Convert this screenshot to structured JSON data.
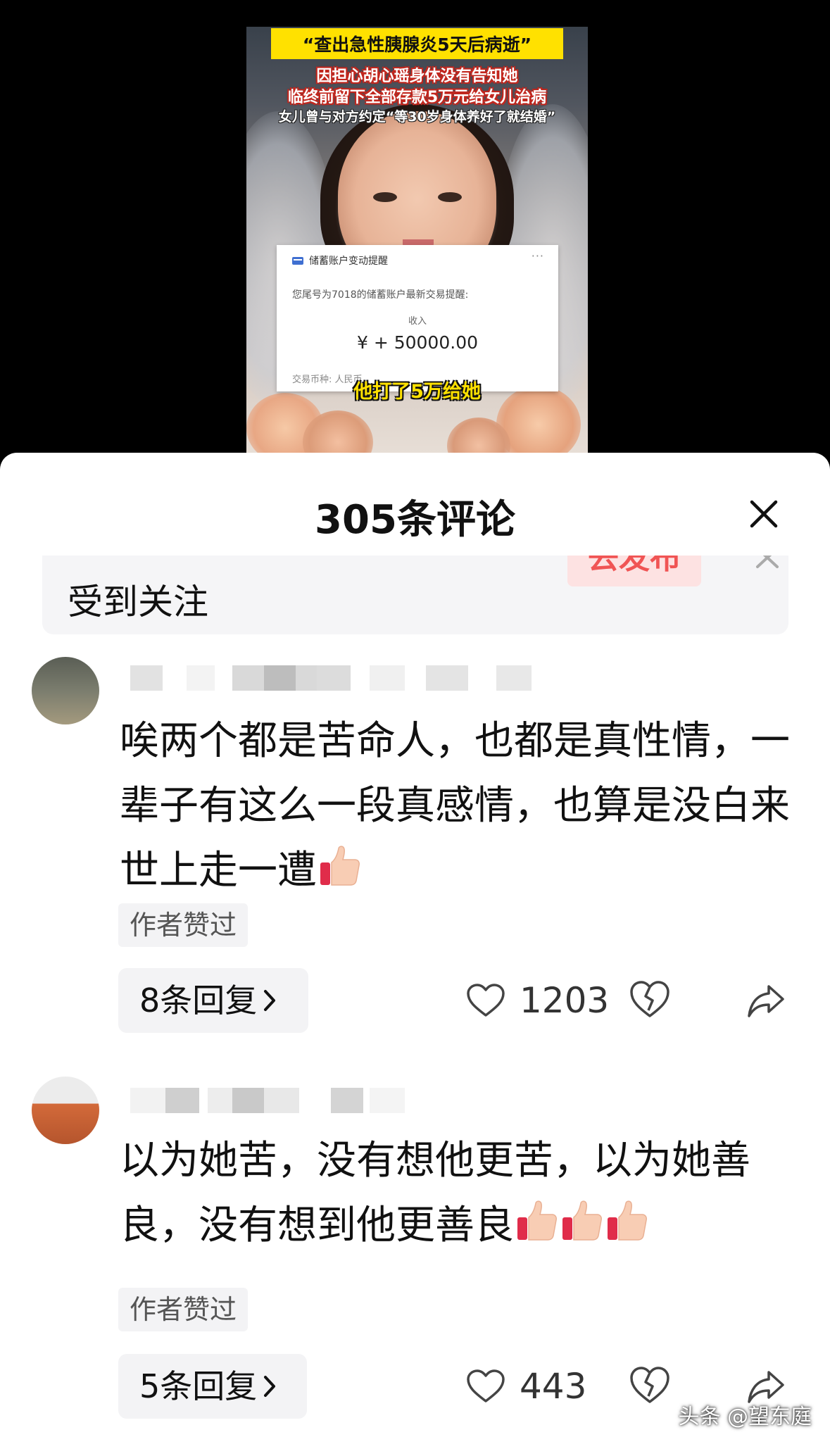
{
  "video": {
    "title_box": "“查出急性胰腺炎5天后病逝”",
    "caption_lines": [
      "因担心胡心瑶身体没有告知她",
      "临终前留下全部存款5万元给女儿治病",
      "女儿曾与对方约定“等30岁身体养好了就结婚”"
    ],
    "bank_card": {
      "header": "储蓄账户变动提醒",
      "menu": "···",
      "description": "您尾号为7018的储蓄账户最新交易提醒:",
      "income_label": "收入",
      "amount": "¥ + 50000.00",
      "currency_row": "交易币种:   人民币"
    },
    "bottom_caption": "他打了5万给她"
  },
  "sheet": {
    "title": "305条评论",
    "close_icon": "close-icon"
  },
  "banner": {
    "text": "受到关注",
    "action_label": "去发布",
    "colors": {
      "action_bg": "#fde2e2",
      "action_text": "#f05454"
    }
  },
  "comments": [
    {
      "text": "唉两个都是苦命人，也都是真性情，一辈子有这么一段真感情，也算是没白来世上走一遭",
      "emoji": [
        "thumbs-up-icon"
      ],
      "author_badge": "作者赞过",
      "replies_label": "8条回复",
      "likes": "1203"
    },
    {
      "text": "以为她苦，没有想他更苦，以为她善良，没有想到他更善良",
      "emoji": [
        "thumbs-up-icon",
        "thumbs-up-icon",
        "thumbs-up-icon"
      ],
      "author_badge": "作者赞过",
      "replies_label": "5条回复",
      "likes": "443"
    }
  ],
  "watermark": "头条 @望东庭"
}
